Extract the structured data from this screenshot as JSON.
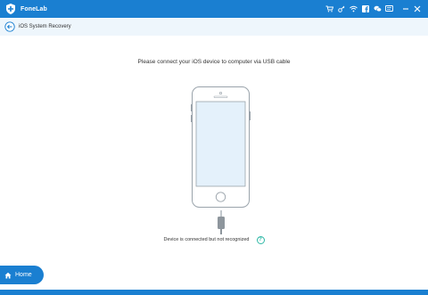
{
  "app": {
    "title": "FoneLab",
    "icon": "fonelab-logo-icon"
  },
  "titlebar": {
    "icons": [
      "cart-icon",
      "key-icon",
      "wifi-icon",
      "facebook-icon",
      "chat-icon",
      "feedback-icon",
      "minimize-icon",
      "close-icon"
    ]
  },
  "subheader": {
    "back_icon": "back-arrow-icon",
    "title": "iOS System Recovery"
  },
  "main": {
    "instruction": "Please connect your iOS device to computer via USB cable",
    "status": "Device is connected but not recognized",
    "help_symbol": "?"
  },
  "footer": {
    "home_label": "Home",
    "home_icon": "home-icon"
  },
  "colors": {
    "accent": "#1a7fd1",
    "subheader_bg": "#eef6fc",
    "help": "#2fb8a6"
  }
}
